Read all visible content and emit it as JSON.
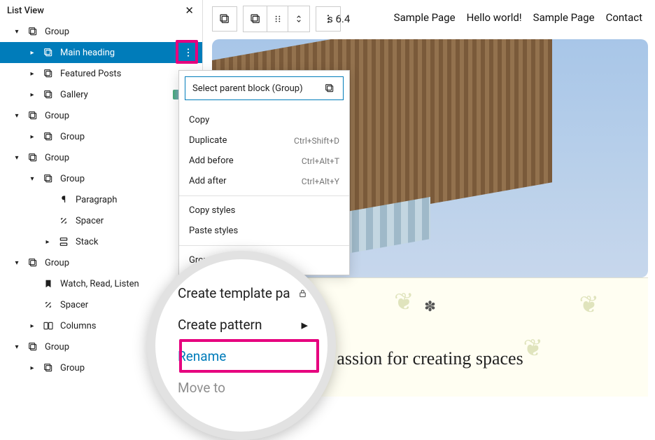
{
  "panel": {
    "title": "List View"
  },
  "tree": {
    "group": "Group",
    "main_heading": "Main heading",
    "featured_posts": "Featured Posts",
    "gallery": "Gallery",
    "paragraph": "Paragraph",
    "spacer": "Spacer",
    "stack": "Stack",
    "watch": "Watch, Read, Listen",
    "columns": "Columns"
  },
  "toolbar": {
    "site_title_fragment": "s 6.4"
  },
  "nav": {
    "sample1": "Sample Page",
    "hello": "Hello world!",
    "sample2": "Sample Page",
    "contact": "Contact"
  },
  "menu": {
    "parent": "Select parent block (Group)",
    "copy": "Copy",
    "duplicate": "Duplicate",
    "duplicate_sc": "Ctrl+Shift+D",
    "add_before": "Add before",
    "add_before_sc": "Ctrl+Alt+T",
    "add_after": "Add after",
    "add_after_sc": "Ctrl+Alt+Y",
    "copy_styles": "Copy styles",
    "paste_styles": "Paste styles",
    "group_action": "Group"
  },
  "lens": {
    "create_template": "Create template pa",
    "create_pattern": "Create pattern",
    "rename": "Rename",
    "move_to": "Move to"
  },
  "canvas": {
    "headline": "assion for creating spaces"
  }
}
